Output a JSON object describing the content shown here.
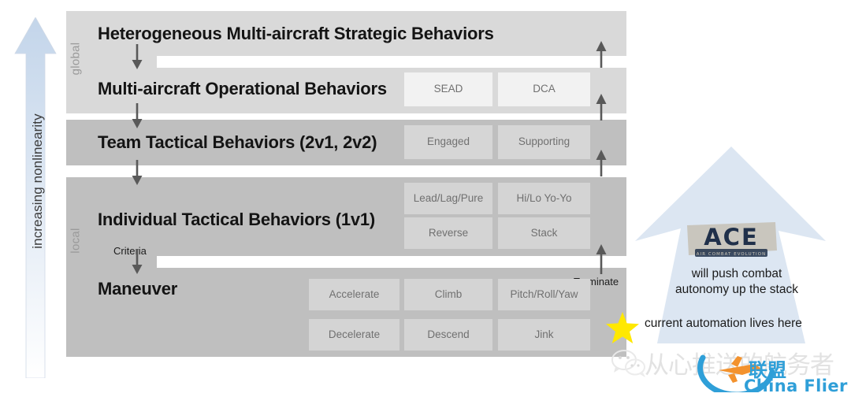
{
  "diagram": {
    "left_axis_label": "increasing nonlinearity",
    "scope_labels": {
      "global": "global",
      "local": "local"
    },
    "levels": [
      {
        "id": "strategic",
        "title": "Heterogeneous Multi-aircraft Strategic Behaviors",
        "scope": "global",
        "chips": []
      },
      {
        "id": "operational",
        "title": "Multi-aircraft Operational Behaviors",
        "scope": "global",
        "chips": [
          "SEAD",
          "DCA"
        ]
      },
      {
        "id": "team-tactical",
        "title": "Team Tactical Behaviors (2v1, 2v2)",
        "scope": "local",
        "chips": [
          "Engaged",
          "Supporting"
        ]
      },
      {
        "id": "individual-tactical",
        "title": "Individual Tactical Behaviors (1v1)",
        "scope": "local",
        "chips": [
          "Lead/Lag/Pure",
          "Hi/Lo Yo-Yo",
          "Reverse",
          "Stack"
        ]
      },
      {
        "id": "maneuver",
        "title": "Maneuver",
        "scope": "local",
        "chips": [
          "Accelerate",
          "Climb",
          "Pitch/Roll/Yaw",
          "Decelerate",
          "Descend",
          "Jink"
        ]
      }
    ],
    "annotations": {
      "criteria": "Criteria",
      "terminate": "Terminate"
    },
    "colors": {
      "panel_global": "#d9d9d9",
      "panel_local": "#bfbfbf",
      "chip_light": "#f2f2f2",
      "chip_medium": "#d6d6d6",
      "arrow_fill": "#dce6f2",
      "star": "#ffe800",
      "brand_blue": "#2f9fd8"
    }
  },
  "ace": {
    "logo_title": "ACE",
    "logo_subtitle": "AIR COMBAT EVOLUTION",
    "arrow_caption_line1": "will push combat",
    "arrow_caption_line2": "autonomy up the stack",
    "current_label": "current automation lives here"
  },
  "watermark": {
    "chinese_text": "从心推送的航务者",
    "alliance_text": "联盟",
    "brand_text": "China Flier"
  }
}
